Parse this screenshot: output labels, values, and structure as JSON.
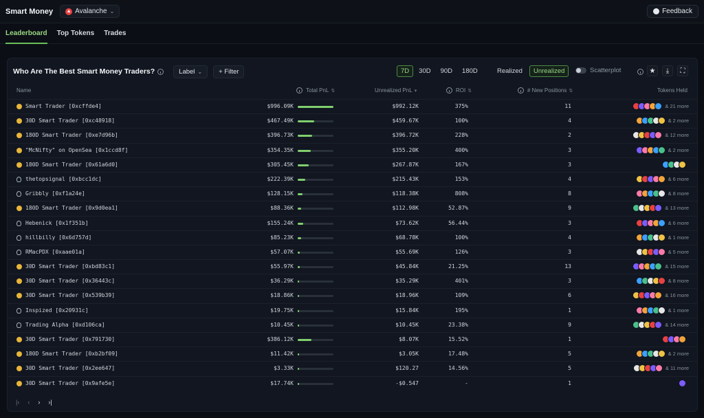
{
  "app": {
    "title": "Smart Money",
    "chain": "Avalanche",
    "feedback_label": "Feedback"
  },
  "nav": {
    "tabs": [
      {
        "label": "Leaderboard"
      },
      {
        "label": "Top Tokens"
      },
      {
        "label": "Trades"
      }
    ]
  },
  "panel": {
    "title": "Who Are The Best Smart Money Traders?",
    "label_select": "Label",
    "filter_label": "+ Filter",
    "periods": [
      "7D",
      "30D",
      "90D",
      "180D"
    ],
    "active_period": "7D",
    "realized_label": "Realized",
    "unrealized_label": "Unrealized",
    "scatter_label": "Scatterplot"
  },
  "columns": {
    "name": "Name",
    "total_pnl": "Total PnL",
    "unrealized_pnl": "Unrealized PnL",
    "roi": "ROI",
    "new_positions": "# New Positions",
    "tokens_held": "Tokens Held"
  },
  "colors": {
    "accent": "#7fcf6e",
    "avax": "#e84142"
  },
  "rows": [
    {
      "icon": "smiley",
      "name": "Smart Trader [0xcffde4]",
      "total_pnl": "$996.09K",
      "pnl_fraction": 1.0,
      "unrealized": "$992.12K",
      "roi": "375%",
      "new_positions": "11",
      "more": "& 21 more"
    },
    {
      "icon": "smiley",
      "name": "30D Smart Trader [0xc48918]",
      "total_pnl": "$467.49K",
      "pnl_fraction": 0.47,
      "unrealized": "$459.67K",
      "roi": "100%",
      "new_positions": "4",
      "more": "& 2 more"
    },
    {
      "icon": "smiley",
      "name": "180D Smart Trader [0xe7d96b]",
      "total_pnl": "$396.73K",
      "pnl_fraction": 0.4,
      "unrealized": "$396.72K",
      "roi": "228%",
      "new_positions": "2",
      "more": "& 12 more"
    },
    {
      "icon": "smiley",
      "name": "\"McNifty\" on OpenSea [0x1ccd8f]",
      "total_pnl": "$354.35K",
      "pnl_fraction": 0.36,
      "unrealized": "$355.20K",
      "roi": "400%",
      "new_positions": "3",
      "more": "& 2 more"
    },
    {
      "icon": "smiley",
      "name": "180D Smart Trader [0x61a6d0]",
      "total_pnl": "$305.45K",
      "pnl_fraction": 0.31,
      "unrealized": "$267.87K",
      "roi": "167%",
      "new_positions": "3",
      "more": ""
    },
    {
      "icon": "bulb",
      "name": "thetopsignal [0xbcc1dc]",
      "total_pnl": "$222.39K",
      "pnl_fraction": 0.22,
      "unrealized": "$215.43K",
      "roi": "153%",
      "new_positions": "4",
      "more": "& 6 more"
    },
    {
      "icon": "bulb",
      "name": "Gribbly [0xf1a24e]",
      "total_pnl": "$128.15K",
      "pnl_fraction": 0.13,
      "unrealized": "$118.38K",
      "roi": "808%",
      "new_positions": "8",
      "more": "& 8 more"
    },
    {
      "icon": "smiley",
      "name": "180D Smart Trader [0x9d0ea1]",
      "total_pnl": "$88.36K",
      "pnl_fraction": 0.09,
      "unrealized": "$112.98K",
      "roi": "52.87%",
      "new_positions": "9",
      "more": "& 13 more"
    },
    {
      "icon": "bulb",
      "name": "Hebenick [0x1f351b]",
      "total_pnl": "$155.24K",
      "pnl_fraction": 0.16,
      "unrealized": "$73.62K",
      "roi": "56.44%",
      "new_positions": "3",
      "more": "& 6 more"
    },
    {
      "icon": "bulb",
      "name": "hillbilly [0x6d757d]",
      "total_pnl": "$85.23K",
      "pnl_fraction": 0.09,
      "unrealized": "$68.78K",
      "roi": "100%",
      "new_positions": "4",
      "more": "& 1 more"
    },
    {
      "icon": "bulb",
      "name": "RMacPDX [0xaae01a]",
      "total_pnl": "$57.07K",
      "pnl_fraction": 0.06,
      "unrealized": "$55.69K",
      "roi": "126%",
      "new_positions": "3",
      "more": "& 5 more"
    },
    {
      "icon": "smiley",
      "name": "30D Smart Trader [0xbd83c1]",
      "total_pnl": "$55.97K",
      "pnl_fraction": 0.06,
      "unrealized": "$45.84K",
      "roi": "21.25%",
      "new_positions": "13",
      "more": "& 15 more"
    },
    {
      "icon": "smiley",
      "name": "30D Smart Trader [0x36443c]",
      "total_pnl": "$36.29K",
      "pnl_fraction": 0.04,
      "unrealized": "$35.29K",
      "roi": "401%",
      "new_positions": "3",
      "more": "& 8 more"
    },
    {
      "icon": "smiley",
      "name": "30D Smart Trader [0x539b39]",
      "total_pnl": "$18.86K",
      "pnl_fraction": 0.02,
      "unrealized": "$18.96K",
      "roi": "109%",
      "new_positions": "6",
      "more": "& 16 more"
    },
    {
      "icon": "bulb",
      "name": "Inspized [0x20931c]",
      "total_pnl": "$19.75K",
      "pnl_fraction": 0.02,
      "unrealized": "$15.84K",
      "roi": "195%",
      "new_positions": "1",
      "more": "& 1 more"
    },
    {
      "icon": "bulb",
      "name": "Trading Alpha [0xd106ca]",
      "total_pnl": "$10.45K",
      "pnl_fraction": 0.01,
      "unrealized": "$10.45K",
      "roi": "23.38%",
      "new_positions": "9",
      "more": "& 14 more"
    },
    {
      "icon": "smiley",
      "name": "30D Smart Trader [0x791730]",
      "total_pnl": "$386.12K",
      "pnl_fraction": 0.39,
      "unrealized": "$8.07K",
      "roi": "15.52%",
      "new_positions": "1",
      "more": ""
    },
    {
      "icon": "smiley",
      "name": "180D Smart Trader [0xb2bf09]",
      "total_pnl": "$11.42K",
      "pnl_fraction": 0.01,
      "unrealized": "$3.05K",
      "roi": "17.48%",
      "new_positions": "5",
      "more": "& 2 more"
    },
    {
      "icon": "smiley",
      "name": "30D Smart Trader [0x2ee647]",
      "total_pnl": "$3.33K",
      "pnl_fraction": 0.004,
      "unrealized": "$120.27",
      "roi": "14.56%",
      "new_positions": "5",
      "more": "& 11 more"
    },
    {
      "icon": "smiley",
      "name": "30D Smart Trader [0x9afe5e]",
      "total_pnl": "$17.74K",
      "pnl_fraction": 0.02,
      "unrealized": "-$0.547",
      "roi": "-",
      "new_positions": "1",
      "more": ""
    }
  ],
  "pager": {
    "first": "|‹",
    "prev": "‹",
    "next": "›",
    "last": "›|"
  }
}
